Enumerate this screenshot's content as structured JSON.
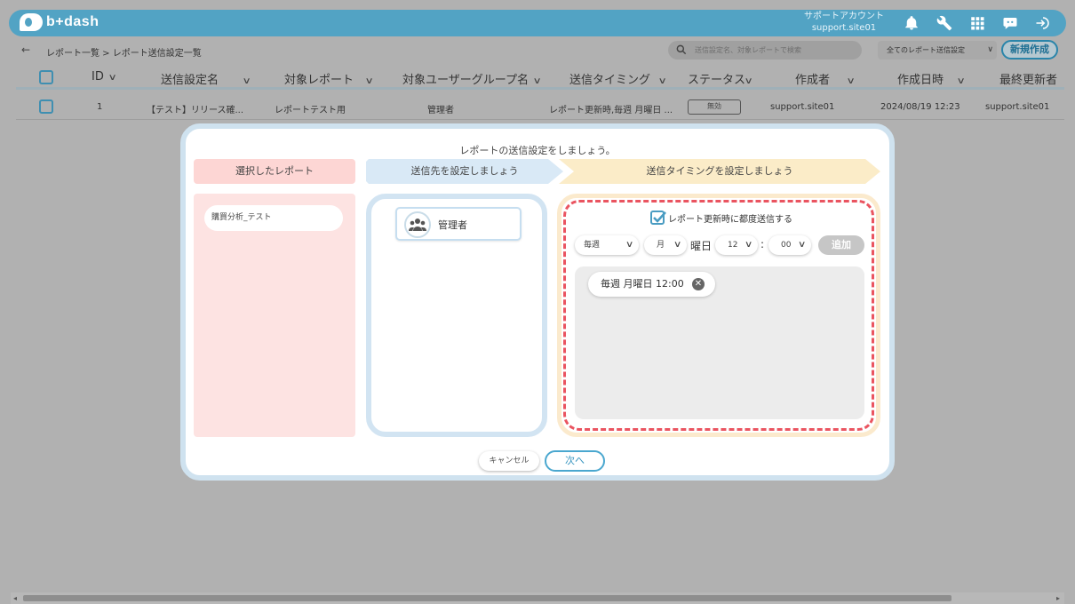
{
  "header": {
    "logo_text": "b+dash",
    "account_line1": "サポートアカウント",
    "account_line2": "support.site01"
  },
  "icons": [
    "bell-icon",
    "wrench-icon",
    "apps-grid-icon",
    "chat-bot-icon",
    "logout-icon"
  ],
  "breadcrumb": {
    "back": "←",
    "text": "レポート一覧 > レポート送信設定一覧"
  },
  "search": {
    "placeholder": "送信設定名、対象レポートで検索"
  },
  "filter": {
    "selected": "全てのレポート送信設定"
  },
  "new_button": "新規作成",
  "table": {
    "headers": [
      "ID",
      "送信設定名",
      "対象レポート",
      "対象ユーザーグループ名",
      "送信タイミング",
      "ステータス",
      "作成者",
      "作成日時",
      "最終更新者"
    ],
    "rows": [
      {
        "id": "1",
        "name": "【テスト】リリース確...",
        "report": "レポートテスト用",
        "group": "管理者",
        "timing": "レポート更新時,毎週 月曜日 ...",
        "status": "無効",
        "creator": "support.site01",
        "created": "2024/08/19 12:23",
        "updater": "support.site01"
      }
    ]
  },
  "modal": {
    "title": "レポートの送信設定をしましょう。",
    "steps": [
      "選択したレポート",
      "送信先を設定しましょう",
      "送信タイミングを設定しましょう"
    ],
    "selected_report": "購買分析_テスト",
    "group_name": "管理者",
    "checkbox_label": "レポート更新時に都度送信する",
    "checkbox_checked": true,
    "freq_value": "毎週",
    "day_value": "月",
    "day_label": "曜日",
    "hour_value": "12",
    "colon": ":",
    "minute_value": "00",
    "add_button": "追加",
    "timing_chip": "毎週 月曜日 12:00",
    "cancel_button": "キャンセル",
    "next_button": "次へ"
  },
  "colors": {
    "brand": "#52a3c4",
    "step1": "#fdd6d4",
    "step2": "#d9e9f6",
    "step3": "#fbecc8",
    "dashed_highlight": "#ea5460"
  }
}
